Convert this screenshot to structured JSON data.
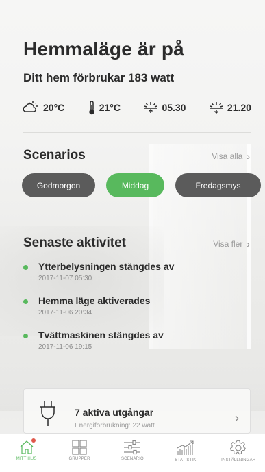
{
  "hero": {
    "title": "Hemmaläge är på",
    "subtitle": "Ditt hem förbrukar 183 watt"
  },
  "weather": {
    "outdoor_temp": "20°C",
    "indoor_temp": "21°C",
    "sunrise": "05.30",
    "sunset": "21.20"
  },
  "scenarios": {
    "title": "Scenarios",
    "link": "Visa alla",
    "items": [
      {
        "label": "Godmorgon",
        "active": false
      },
      {
        "label": "Middag",
        "active": true
      },
      {
        "label": "Fredagsmys",
        "active": false
      }
    ]
  },
  "activity": {
    "title": "Senaste aktivitet",
    "link": "Visa fler",
    "items": [
      {
        "title": "Ytterbelysningen stängdes av",
        "time": "2017-11-07  05:30"
      },
      {
        "title": "Hemma läge aktiverades",
        "time": "2017-11-06  20:34"
      },
      {
        "title": "Tvättmaskinen stängdes av",
        "time": "2017-11-06  19:15"
      }
    ]
  },
  "outlets": {
    "title": "7 aktiva utgångar",
    "subtitle": "Energiförbrukning: 22 watt"
  },
  "tabbar": {
    "tabs": [
      {
        "label": "MITT HUS",
        "icon": "home-icon",
        "active": true
      },
      {
        "label": "GRUPPER",
        "icon": "grid-icon",
        "active": false
      },
      {
        "label": "SCENARIO",
        "icon": "sliders-icon",
        "active": false
      },
      {
        "label": "STATISTIK",
        "icon": "chart-icon",
        "active": false
      },
      {
        "label": "INSTÄLLNINGAR",
        "icon": "gear-icon",
        "active": false
      }
    ]
  },
  "colors": {
    "accent": "#58b95d",
    "chip_dark": "#5b5b5b",
    "notification": "#e0584b"
  }
}
